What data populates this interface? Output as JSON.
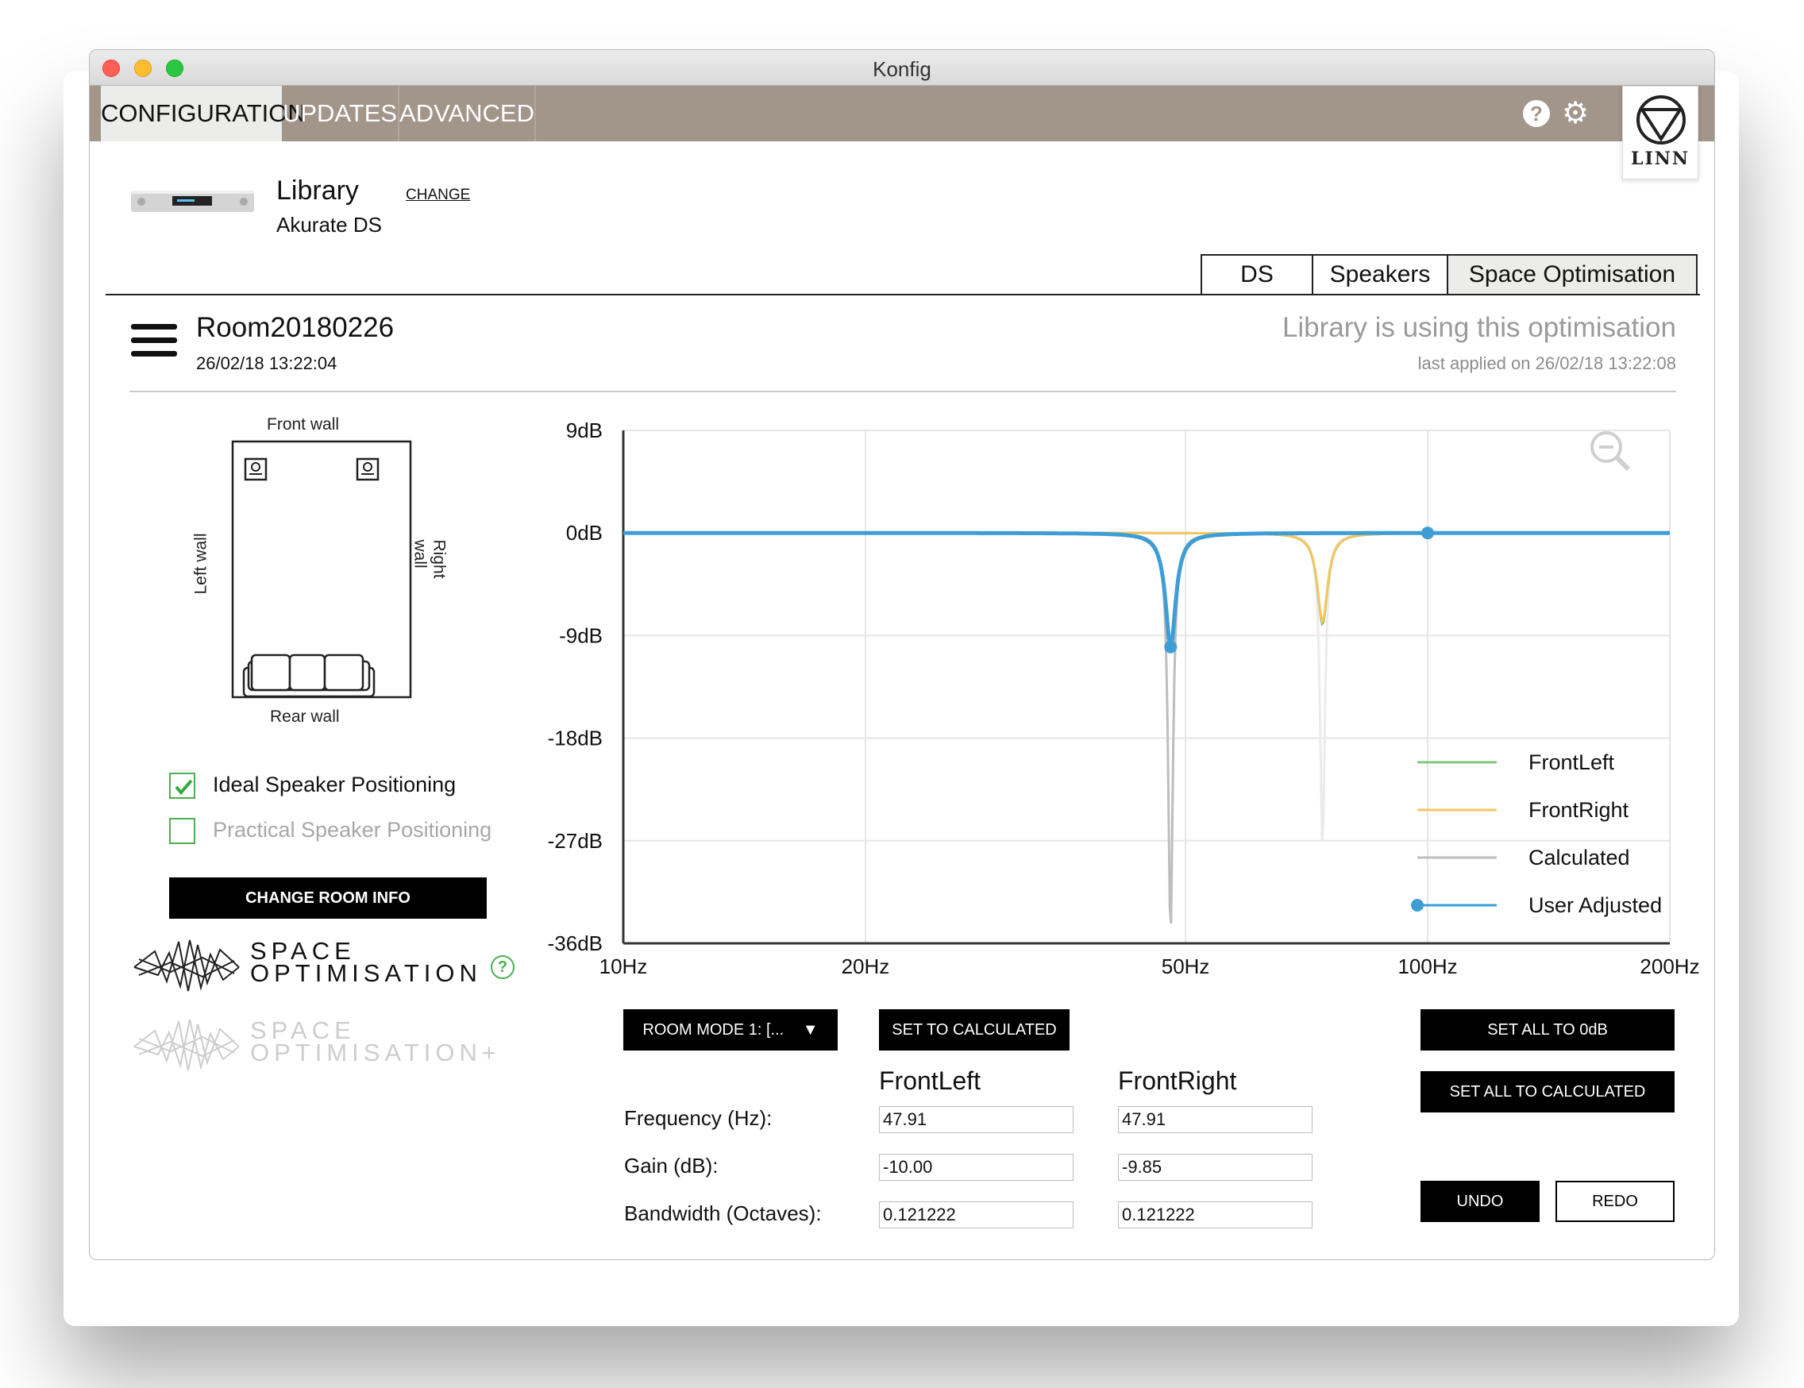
{
  "window": {
    "title": "Konfig"
  },
  "tabs": [
    {
      "label": "CONFIGURATION",
      "active": true
    },
    {
      "label": "UPDATES",
      "active": false
    },
    {
      "label": "ADVANCED",
      "active": false
    }
  ],
  "toolbar": {
    "help_icon": "?",
    "settings_icon": "gear-icon"
  },
  "brand": {
    "logo_text": "LINN"
  },
  "device": {
    "name": "Library",
    "model": "Akurate DS",
    "change_label": "CHANGE"
  },
  "sub_tabs": [
    {
      "label": "DS",
      "active": false
    },
    {
      "label": "Speakers",
      "active": false
    },
    {
      "label": "Space Optimisation",
      "active": true
    }
  ],
  "room": {
    "name": "Room20180226",
    "date": "26/02/18 13:22:04",
    "status": "Library is using this optimisation",
    "last_applied": "last applied on 26/02/18 13:22:08"
  },
  "diagram": {
    "front": "Front wall",
    "rear": "Rear wall",
    "left": "Left wall",
    "right": "Right wall"
  },
  "positioning": {
    "ideal": {
      "label": "Ideal Speaker Positioning",
      "checked": true
    },
    "practical": {
      "label": "Practical Speaker Positioning",
      "checked": false
    }
  },
  "buttons": {
    "change_room": "CHANGE ROOM INFO",
    "room_mode": "ROOM MODE 1: [...",
    "set_to_calculated": "SET TO CALCULATED",
    "set_all_0db": "SET ALL TO 0dB",
    "set_all_calculated": "SET ALL TO CALCULATED",
    "undo": "UNDO",
    "redo": "REDO"
  },
  "logos": {
    "so_line1": "SPACE",
    "so_line2": "OPTIMISATION",
    "so_plus_line1": "SPACE",
    "so_plus_line2": "OPTIMISATION+"
  },
  "params": {
    "frequency_label": "Frequency (Hz):",
    "gain_label": "Gain (dB):",
    "bandwidth_label": "Bandwidth (Octaves):",
    "front_left": {
      "header": "FrontLeft",
      "frequency": "47.91",
      "gain": "-10.00",
      "bandwidth": "0.121222"
    },
    "front_right": {
      "header": "FrontRight",
      "frequency": "47.91",
      "gain": "-9.85",
      "bandwidth": "0.121222"
    }
  },
  "chart_data": {
    "type": "line",
    "x_scale": "log",
    "xlim": [
      10,
      200
    ],
    "ylim": [
      -36,
      9
    ],
    "x_ticks": [
      {
        "value": 10,
        "label": "10Hz"
      },
      {
        "value": 20,
        "label": "20Hz"
      },
      {
        "value": 50,
        "label": "50Hz"
      },
      {
        "value": 100,
        "label": "100Hz"
      },
      {
        "value": 200,
        "label": "200Hz"
      }
    ],
    "y_ticks": [
      {
        "value": 9,
        "label": "9dB"
      },
      {
        "value": 0,
        "label": "0dB"
      },
      {
        "value": -9,
        "label": "-9dB"
      },
      {
        "value": -18,
        "label": "-18dB"
      },
      {
        "value": -27,
        "label": "-27dB"
      },
      {
        "value": -36,
        "label": "-36dB"
      }
    ],
    "grid": true,
    "legend": "bottom-right",
    "zoom_icon": "zoom-out-icon",
    "series": [
      {
        "name": "FrontLeft",
        "color": "#7dc97d",
        "notches": [
          {
            "f": 74,
            "gain": -8
          }
        ]
      },
      {
        "name": "FrontRight",
        "color": "#f5c560",
        "notches": [
          {
            "f": 74,
            "gain": -7.8
          }
        ]
      },
      {
        "name": "Calculated",
        "color": "#bdbdbd",
        "notches": [
          {
            "f": 47.9,
            "gain": -35
          }
        ]
      },
      {
        "name": "User Adjusted",
        "color": "#3d9ed6",
        "notches": [
          {
            "f": 47.91,
            "gain": -10
          }
        ],
        "markers": [
          {
            "f": 47.91,
            "gain": -10
          },
          {
            "f": 100,
            "gain": 0
          }
        ]
      }
    ],
    "background_trace": {
      "color": "#ebebeb",
      "notches": [
        {
          "f": 74,
          "gain": -27.5
        }
      ]
    }
  }
}
